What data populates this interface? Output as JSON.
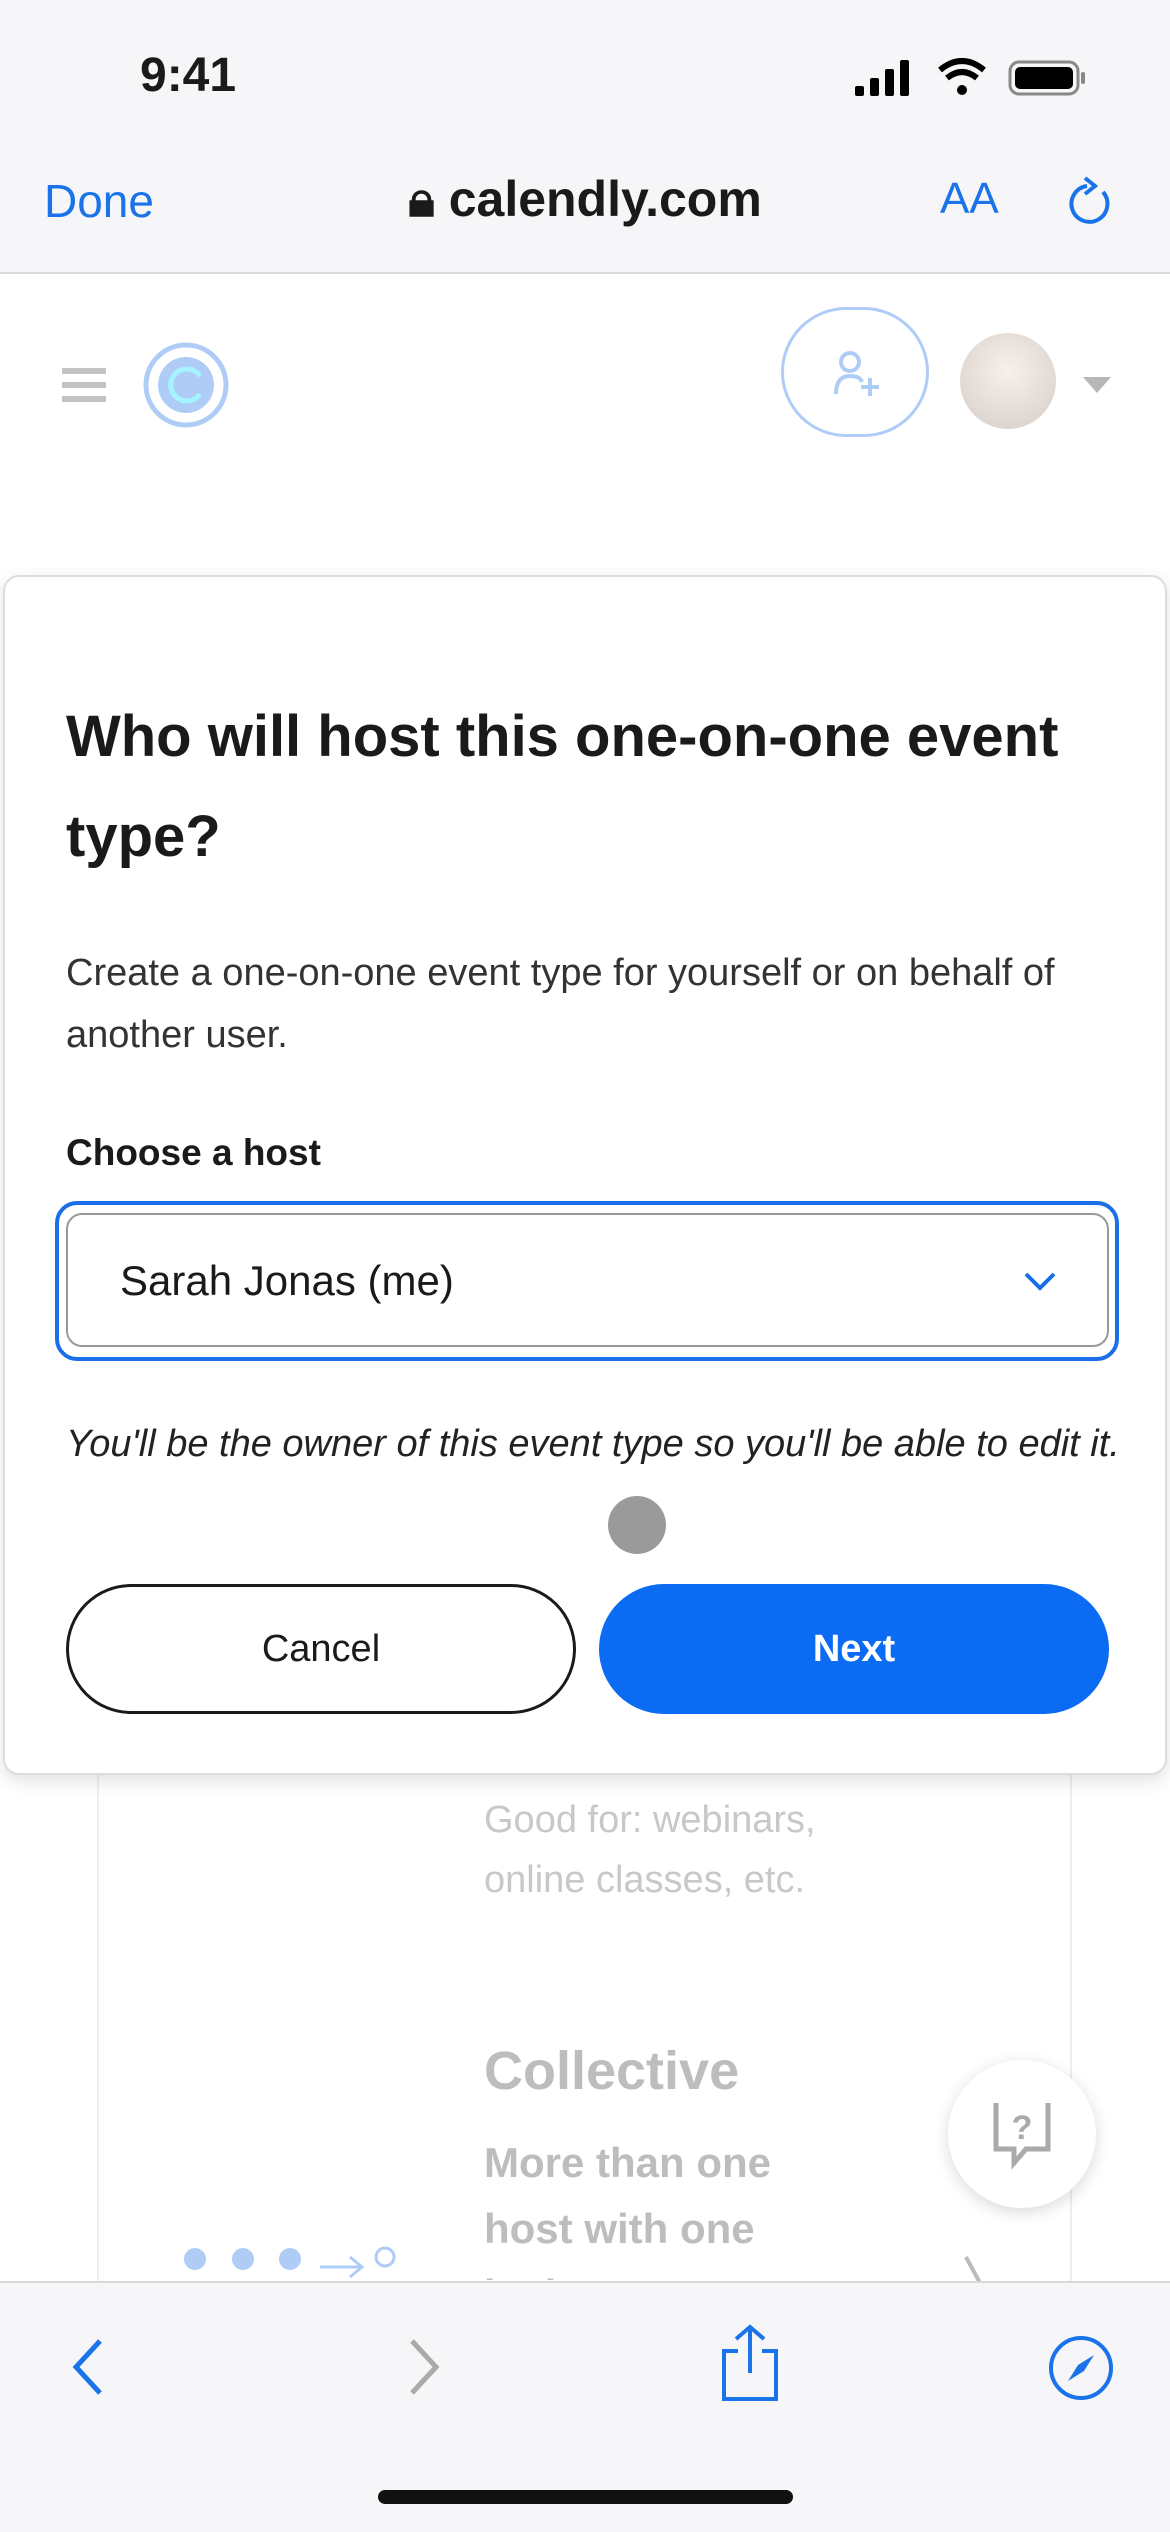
{
  "status": {
    "time": "9:41"
  },
  "safari": {
    "done": "Done",
    "url": "calendly.com",
    "text_size": "AA"
  },
  "modal": {
    "title": "Who will host this one-on-one event type?",
    "description": "Create a one-on-one event type for yourself or on behalf of another user.",
    "host_label": "Choose a host",
    "host_value": "Sarah Jonas (me)",
    "note": "You'll be the owner of this event type so you'll be able to edit it.",
    "cancel": "Cancel",
    "next": "Next"
  },
  "background": {
    "good_for": "Good for: webinars, online classes, etc.",
    "collective_title": "Collective",
    "collective_desc": "More than one host with one invitee"
  },
  "colors": {
    "accent": "#0b6bf2",
    "link": "#1a73e8"
  }
}
